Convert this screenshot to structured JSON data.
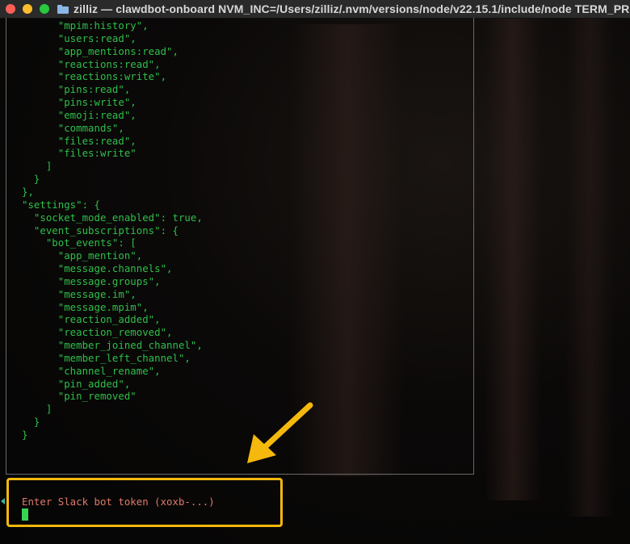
{
  "window": {
    "title": "zilliz — clawdbot-onboard NVM_INC=/Users/zilliz/.nvm/versions/node/v22.15.1/include/node TERM_PROGRAM=Apple_Terminal"
  },
  "terminal": {
    "lines": [
      "      \"mpim:history\",",
      "      \"users:read\",",
      "      \"app_mentions:read\",",
      "      \"reactions:read\",",
      "      \"reactions:write\",",
      "      \"pins:read\",",
      "      \"pins:write\",",
      "      \"emoji:read\",",
      "      \"commands\",",
      "      \"files:read\",",
      "      \"files:write\"",
      "    ]",
      "  }",
      "},",
      "\"settings\": {",
      "  \"socket_mode_enabled\": true,",
      "  \"event_subscriptions\": {",
      "    \"bot_events\": [",
      "      \"app_mention\",",
      "      \"message.channels\",",
      "      \"message.groups\",",
      "      \"message.im\",",
      "      \"message.mpim\",",
      "      \"reaction_added\",",
      "      \"reaction_removed\",",
      "      \"member_joined_channel\",",
      "      \"member_left_channel\",",
      "      \"channel_rename\",",
      "      \"pin_added\",",
      "      \"pin_removed\"",
      "    ]",
      "  }",
      "}",
      ""
    ],
    "prompt": "Enter Slack bot token (xoxb-...)"
  },
  "colors": {
    "code_text": "#2fbf4a",
    "prompt_text": "#e07a6a",
    "cursor": "#39d353",
    "highlight_border": "#f5b80c",
    "arrow": "#f5b80c"
  },
  "icons": {
    "folder": "folder-icon",
    "arrow": "arrow-annotation-icon"
  }
}
